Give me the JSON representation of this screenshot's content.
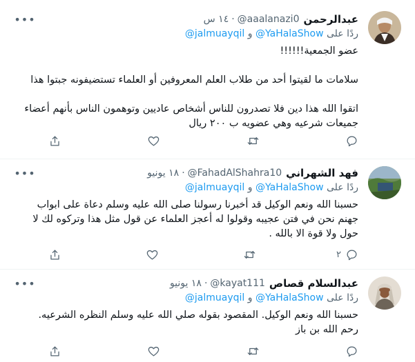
{
  "tweets": [
    {
      "name": "عبدالرحمن",
      "handle": "@aaalanazi0",
      "time": "١٤ س",
      "reply_prefix": "ردًا على",
      "reply_mention1": "@YaHalaShow",
      "reply_and": "و",
      "reply_mention2": "@jalmuayqil",
      "lines": [
        "عضو الجمعية!!!!!!",
        "سلامات ما لقيتوا أحد من طلاب العلم المعروفين أو العلماء تستضيفونه جبتوا هذا",
        "اتقوا الله هذا دين فلا تصدرون للناس أشخاص عاديين وتوهمون الناس بأنهم أعضاء",
        "جميعات شرعيه وهي عضويه ب ٢٠٠ ريال"
      ],
      "reply_count": "",
      "retweet_count": "",
      "like_count": ""
    },
    {
      "name": "فهد الشهراني",
      "handle": "@FahadAlShahra10",
      "time": "١٨ يونيو",
      "reply_prefix": "ردًا على",
      "reply_mention1": "@YaHalaShow",
      "reply_and": "و",
      "reply_mention2": "@jalmuayqil",
      "lines": [
        "حسبنا الله ونعم الوكيل قد أخبرنا رسولنا صلى الله عليه وسلم دعاة على ابواب",
        "جهنم نحن في فتن عجيبه وقولوا له أعجز العلماء عن قول مثل هذا وتركوه لك لا",
        "حول ولا قوة الا بالله ."
      ],
      "reply_count": "٢",
      "retweet_count": "",
      "like_count": ""
    },
    {
      "name": "عبدالسلام قصاص",
      "handle": "@kayat111",
      "time": "١٨ يونيو",
      "reply_prefix": "ردًا على",
      "reply_mention1": "@YaHalaShow",
      "reply_and": "و",
      "reply_mention2": "@jalmuayqil",
      "lines": [
        "حسبنا الله ونعم الوكيل. المقصود بقوله صلي الله عليه وسلم النظره الشرعيه.",
        "رحم الله بن باز"
      ],
      "reply_count": "",
      "retweet_count": "",
      "like_count": ""
    }
  ],
  "icons": {
    "more": "more-horizontal-icon",
    "reply": "reply-bubble-icon",
    "retweet": "retweet-icon",
    "like": "heart-icon",
    "share": "share-upload-icon"
  },
  "colors": {
    "link": "#1d9bf0",
    "secondary_text": "#536471",
    "divider": "#eff3f4"
  }
}
